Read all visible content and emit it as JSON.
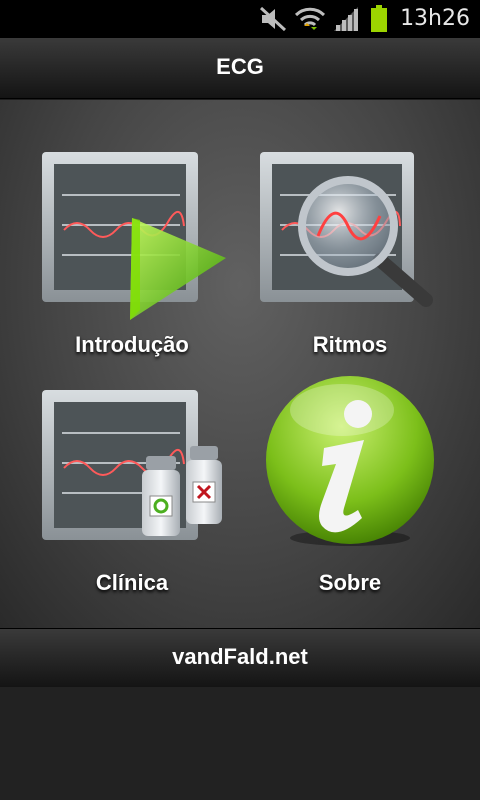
{
  "status_bar": {
    "time": "13h26",
    "icons": [
      "mute-icon",
      "wifi-icon",
      "signal-icon",
      "battery-icon"
    ],
    "battery_color": "#9cd400"
  },
  "header": {
    "title": "ECG"
  },
  "menu": {
    "items": [
      {
        "label": "Introdução",
        "icon": "play-monitor-icon"
      },
      {
        "label": "Ritmos",
        "icon": "magnifier-monitor-icon"
      },
      {
        "label": "Clínica",
        "icon": "vials-monitor-icon"
      },
      {
        "label": "Sobre",
        "icon": "info-icon"
      }
    ]
  },
  "footer": {
    "link": "vandFald.net"
  }
}
